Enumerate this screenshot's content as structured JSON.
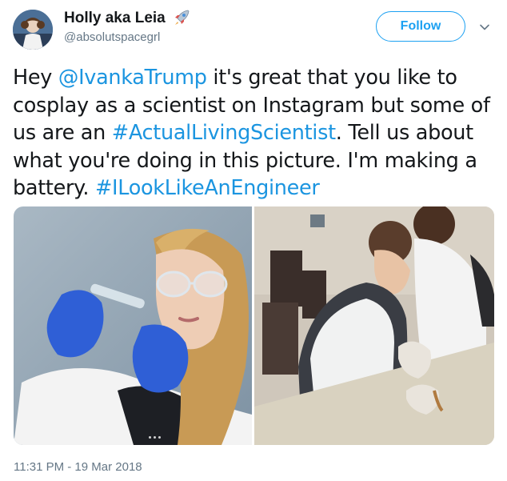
{
  "author": {
    "display_name": "Holly aka Leia",
    "handle": "@absolutspacegrl",
    "name_emoji": "rocket-icon"
  },
  "actions": {
    "follow_label": "Follow",
    "menu_icon": "chevron-down-icon"
  },
  "tweet": {
    "t1": "Hey ",
    "mention": "@IvankaTrump",
    "t2": " it's great that you like to cosplay as a scientist on Instagram but some of us are an ",
    "hashtag1": "#ActualLivingScientist",
    "t3": ". Tell us about what you're doing in this picture. I'm making a battery. ",
    "hashtag2": "#ILookLikeAnEngineer"
  },
  "media": {
    "left_photo": "woman-in-lab-goggles-photo",
    "right_photo": "women-at-lab-bench-photo"
  },
  "meta": {
    "timestamp": "11:31 PM - 19 Mar 2018"
  },
  "colors": {
    "accent": "#1da1f2",
    "link": "#1b95e0",
    "muted": "#657786",
    "text": "#14171a"
  }
}
